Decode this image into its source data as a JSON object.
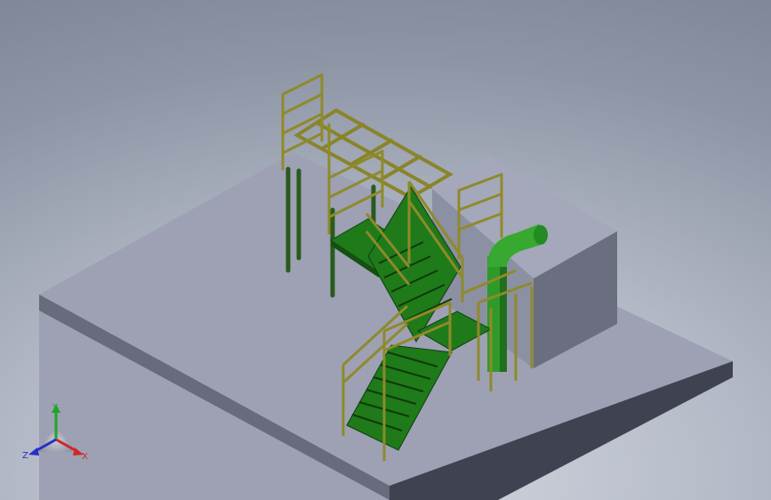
{
  "viewport": {
    "background_top": "#7c8495",
    "background_bottom": "#d2d6df"
  },
  "colors": {
    "base_top": "#9da1b3",
    "base_left": "#6c7080",
    "base_front": "#3f4250",
    "block_top": "#a4a8ba",
    "block_front": "#6b6e7e",
    "block_side": "#8a8ea0",
    "steel_green": "#2f6a1e",
    "deck_green": "#1f7a1a",
    "railing_yellow": "#8f8a2a",
    "pipe_green": "#2f9a2a"
  },
  "triad": {
    "x_label": "X",
    "y_label": "Y",
    "z_label": "Z",
    "x_color": "#d0262a",
    "y_color": "#1ea62a",
    "z_color": "#2430c8"
  }
}
